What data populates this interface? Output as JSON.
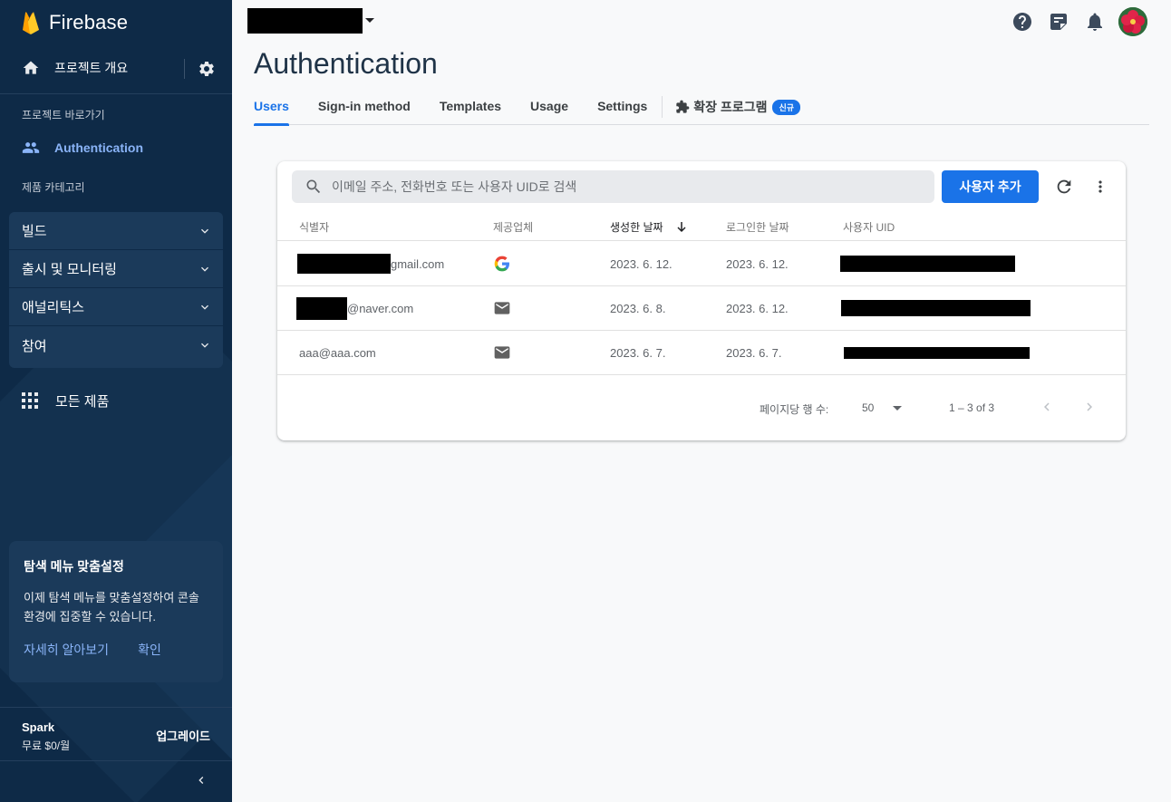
{
  "sidebar": {
    "brand": "Firebase",
    "overview_label": "프로젝트 개요",
    "shortcuts_caption": "프로젝트 바로가기",
    "active_item": "Authentication",
    "category_caption": "제품 카테고리",
    "categories": [
      {
        "label": "빌드"
      },
      {
        "label": "출시 및 모니터링"
      },
      {
        "label": "애널리틱스"
      },
      {
        "label": "참여"
      }
    ],
    "all_products": "모든 제품",
    "promo": {
      "title": "탐색 메뉴 맞춤설정",
      "body": "이제 탐색 메뉴를 맞춤설정하여 콘솔 환경에 집중할 수 있습니다.",
      "learn_more": "자세히 알아보기",
      "confirm": "확인"
    },
    "plan": {
      "name": "Spark",
      "price": "무료 $0/월",
      "upgrade": "업그레이드"
    }
  },
  "header": {
    "title": "Authentication",
    "icons": [
      "help-icon",
      "feedback-icon",
      "notifications-icon",
      "avatar"
    ]
  },
  "tabs": [
    {
      "label": "Users",
      "active": true
    },
    {
      "label": "Sign-in method"
    },
    {
      "label": "Templates"
    },
    {
      "label": "Usage"
    },
    {
      "label": "Settings"
    }
  ],
  "extension_tab": {
    "label": "확장 프로그램",
    "badge": "신규"
  },
  "users": {
    "search_placeholder": "이메일 주소, 전화번호 또는 사용자 UID로 검색",
    "add_user": "사용자 추가",
    "columns": {
      "identifier": "식별자",
      "provider": "제공업체",
      "created": "생성한 날짜",
      "signed_in": "로그인한 날짜",
      "uid": "사용자 UID"
    },
    "rows": [
      {
        "identifier": "gmail.com",
        "provider": "google",
        "created": "2023. 6. 12.",
        "signed_in": "2023. 6. 12."
      },
      {
        "identifier": "@naver.com",
        "provider": "email",
        "created": "2023. 6. 8.",
        "signed_in": "2023. 6. 12."
      },
      {
        "identifier": "aaa@aaa.com",
        "provider": "email",
        "created": "2023. 6. 7.",
        "signed_in": "2023. 6. 7."
      }
    ],
    "pagination": {
      "rows_per_page_label": "페이지당 행 수:",
      "page_size": "50",
      "range": "1 – 3 of 3"
    }
  },
  "colors": {
    "sidebar_bg": "#0e2a47",
    "accent": "#1a73e8",
    "link": "#8ab4f8"
  }
}
